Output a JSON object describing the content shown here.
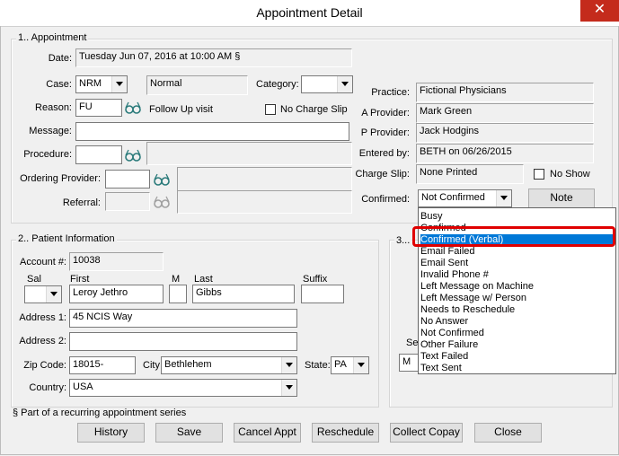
{
  "window": {
    "title": "Appointment Detail",
    "close_glyph": "✕"
  },
  "appointment": {
    "legend": "1.. Appointment",
    "date_label": "Date:",
    "date_value": "Tuesday Jun 07, 2016 at 10:00 AM   §",
    "case_label": "Case:",
    "case_value": "NRM",
    "case_desc": "Normal",
    "category_label": "Category:",
    "category_value": "",
    "reason_label": "Reason:",
    "reason_value": "FU",
    "reason_desc": "Follow Up visit",
    "no_charge_slip_label": "No Charge Slip",
    "message_label": "Message:",
    "message_value": "",
    "procedure_label": "Procedure:",
    "procedure_value": "",
    "ordering_provider_label": "Ordering Provider:",
    "referral_label": "Referral:",
    "practice_label": "Practice:",
    "practice_value": "Fictional Physicians",
    "a_provider_label": "A Provider:",
    "a_provider_value": "Mark  Green",
    "p_provider_label": "P Provider:",
    "p_provider_value": "Jack Hodgins",
    "entered_by_label": "Entered by:",
    "entered_by_value": "BETH on 06/26/2015",
    "charge_slip_label": "Charge Slip:",
    "charge_slip_value": "None Printed",
    "no_show_label": "No Show",
    "confirmed_label": "Confirmed:",
    "confirmed_value": "Not Confirmed",
    "note_button": "Note"
  },
  "patient": {
    "legend": "2.. Patient Information",
    "account_label": "Account #:",
    "account_value": "10038",
    "sal_label": "Sal",
    "first_label": "First",
    "first_value": "Leroy Jethro",
    "m_label": "M",
    "last_label": "Last",
    "last_value": "Gibbs",
    "suffix_label": "Suffix",
    "address1_label": "Address 1:",
    "address1_value": "45 NCIS Way",
    "address2_label": "Address 2:",
    "zip_label": "Zip Code:",
    "zip_value": "18015-",
    "city_label": "City:",
    "city_value": "Bethlehem",
    "state_label": "State:",
    "state_value": "PA",
    "country_label": "Country:",
    "country_value": "USA"
  },
  "section3": {
    "legend_fragment": "3...",
    "se_label": "Se",
    "m_value": "M"
  },
  "footnote": "§  Part of a recurring appointment series",
  "buttons": {
    "history": "History",
    "save": "Save",
    "cancel_appt": "Cancel Appt",
    "reschedule": "Reschedule",
    "collect_copay": "Collect Copay",
    "close": "Close"
  },
  "confirmed_options": [
    "Busy",
    "Confirmed",
    "Confirmed (Verbal)",
    "Email Failed",
    "Email Sent",
    "Invalid Phone #",
    "Left Message on Machine",
    "Left Message w/ Person",
    "Needs to Reschedule",
    "No Answer",
    "Not Confirmed",
    "Other Failure",
    "Text Failed",
    "Text Sent"
  ],
  "selected_option_index": 2,
  "colors": {
    "selection": "#0078d7",
    "highlight_box": "#e00000",
    "close_button": "#c42b1c"
  }
}
